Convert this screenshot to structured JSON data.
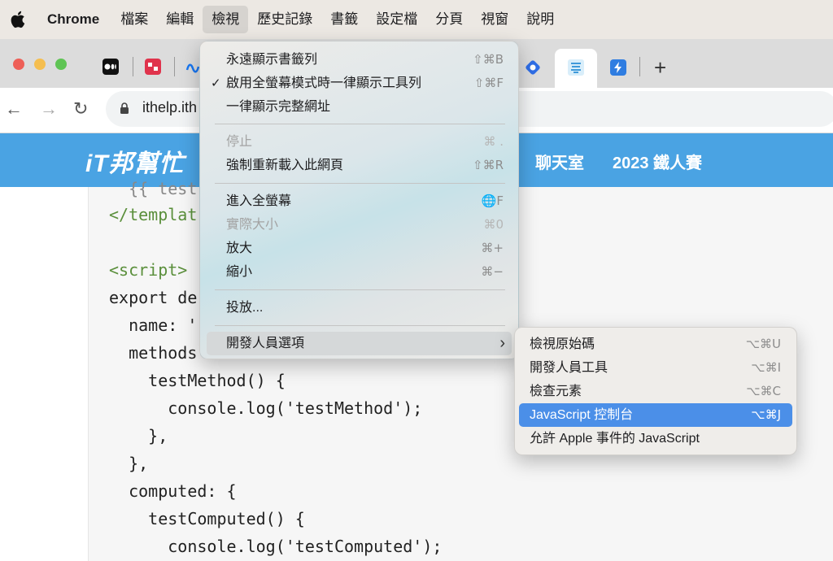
{
  "menubar": {
    "app_name": "Chrome",
    "items": [
      "檔案",
      "編輯",
      "檢視",
      "歷史記錄",
      "書籤",
      "設定檔",
      "分頁",
      "視窗",
      "說明"
    ]
  },
  "browser": {
    "url_text": "ithelp.ith"
  },
  "site": {
    "logo_text": "iT邦幫忙",
    "nav": [
      "聊天室",
      "2023 鐵人賽"
    ]
  },
  "code_lines": [
    "  {{ test",
    "</templat",
    "",
    "<script>",
    "export de",
    "  name: '",
    "  methods",
    "    testMethod() {",
    "      console.log('testMethod');",
    "    },",
    "  },",
    "  computed: {",
    "    testComputed() {",
    "      console.log('testComputed');"
  ],
  "view_menu": {
    "items": [
      {
        "label": "永遠顯示書籤列",
        "shortcut": "⇧⌘B",
        "checked": false,
        "disabled": false
      },
      {
        "label": "啟用全螢幕模式時一律顯示工具列",
        "shortcut": "⇧⌘F",
        "checked": true,
        "disabled": false
      },
      {
        "label": "一律顯示完整網址",
        "shortcut": "",
        "checked": false,
        "disabled": false
      },
      {
        "label": "停止",
        "shortcut": "⌘ .",
        "checked": false,
        "disabled": true
      },
      {
        "label": "強制重新載入此網頁",
        "shortcut": "⇧⌘R",
        "checked": false,
        "disabled": false
      },
      {
        "label": "進入全螢幕",
        "shortcut": "🌐F",
        "checked": false,
        "disabled": false
      },
      {
        "label": "實際大小",
        "shortcut": "⌘0",
        "checked": false,
        "disabled": true
      },
      {
        "label": "放大",
        "shortcut": "⌘+",
        "checked": false,
        "disabled": false
      },
      {
        "label": "縮小",
        "shortcut": "⌘−",
        "checked": false,
        "disabled": false
      },
      {
        "label": "投放...",
        "shortcut": "",
        "checked": false,
        "disabled": false
      },
      {
        "label": "開發人員選項",
        "shortcut": "",
        "checked": false,
        "disabled": false,
        "submenu": true
      }
    ]
  },
  "developer_submenu": {
    "items": [
      {
        "label": "檢視原始碼",
        "shortcut": "⌥⌘U",
        "selected": false
      },
      {
        "label": "開發人員工具",
        "shortcut": "⌥⌘I",
        "selected": false
      },
      {
        "label": "檢查元素",
        "shortcut": "⌥⌘C",
        "selected": false
      },
      {
        "label": "JavaScript 控制台",
        "shortcut": "⌥⌘J",
        "selected": true
      },
      {
        "label": "允許 Apple 事件的 JavaScript",
        "shortcut": "",
        "selected": false
      }
    ]
  },
  "colors": {
    "site_header": "#4aa3e3",
    "menu_highlight": "#4b8fe8",
    "code_tag": "#5a8f3b"
  }
}
